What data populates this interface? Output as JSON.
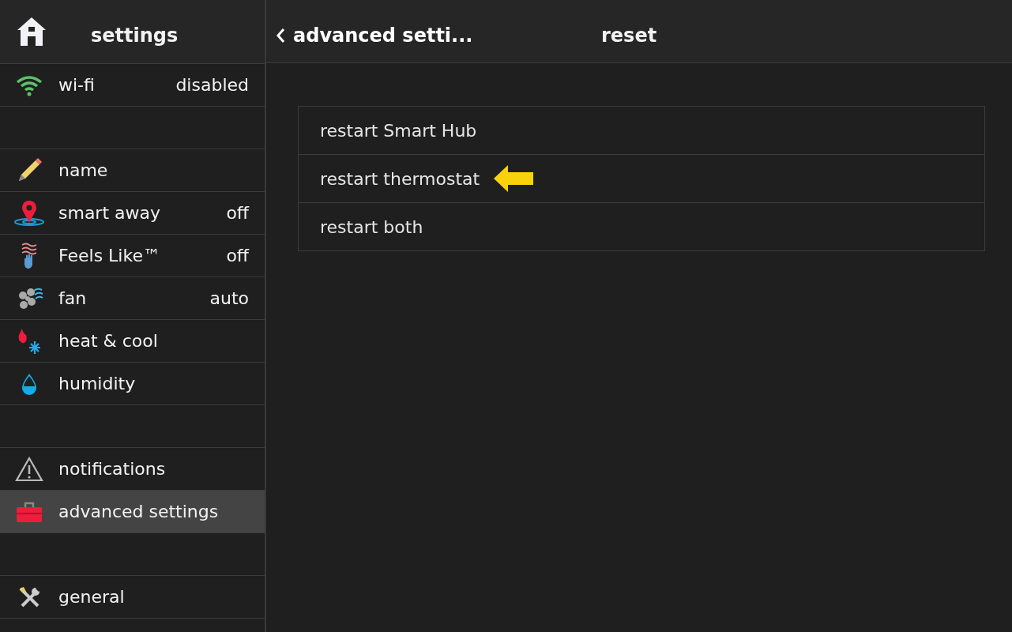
{
  "sidebar": {
    "title": "settings",
    "groups": [
      [
        {
          "label": "wi-fi",
          "value": "disabled",
          "selected": false
        }
      ],
      [
        {
          "label": "name",
          "selected": false
        },
        {
          "label": "smart away",
          "value": "off",
          "selected": false
        },
        {
          "label": "Feels Like™",
          "value": "off",
          "selected": false
        },
        {
          "label": "fan",
          "value": "auto",
          "selected": false
        },
        {
          "label": "heat & cool",
          "selected": false
        },
        {
          "label": "humidity",
          "selected": false
        }
      ],
      [
        {
          "label": "notifications",
          "selected": false
        },
        {
          "label": "advanced settings",
          "selected": true
        }
      ],
      [
        {
          "label": "general",
          "selected": false
        }
      ]
    ]
  },
  "header": {
    "back_label": "advanced setti...",
    "title": "reset"
  },
  "options": [
    {
      "label": "restart Smart Hub",
      "pointed_at": false
    },
    {
      "label": "restart thermostat",
      "pointed_at": true
    },
    {
      "label": "restart both",
      "pointed_at": false
    }
  ]
}
